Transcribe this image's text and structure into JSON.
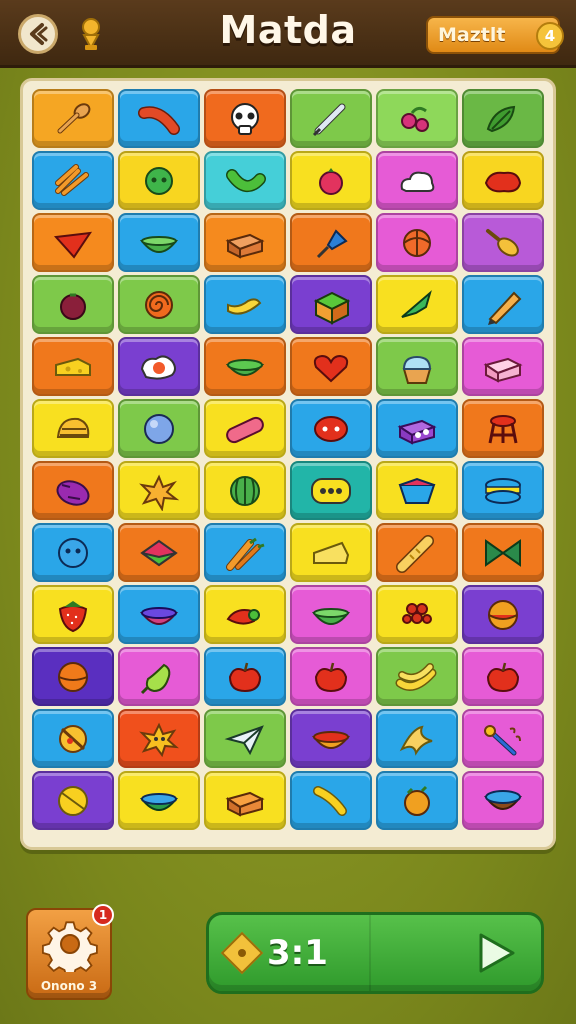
{
  "header": {
    "title": "Matda",
    "right_button_label": "Maztlt",
    "right_button_badge": "4"
  },
  "board": {
    "rows": [
      [
        {
          "color": "#f5a623",
          "icon": "spoon-icon"
        },
        {
          "color": "#2aa6e8",
          "icon": "sausage-icon"
        },
        {
          "color": "#f06a1e",
          "icon": "skull-icon"
        },
        {
          "color": "#7ec94a",
          "icon": "syringe-icon"
        },
        {
          "color": "#8ed85a",
          "icon": "berries-icon"
        },
        {
          "color": "#6ab845",
          "icon": "leaves-icon"
        }
      ],
      [
        {
          "color": "#2aa6e8",
          "icon": "fries-icon"
        },
        {
          "color": "#f8d620",
          "icon": "green-ball-icon"
        },
        {
          "color": "#45cfd8",
          "icon": "pepper-icon"
        },
        {
          "color": "#f8e020",
          "icon": "tomato-icon"
        },
        {
          "color": "#e65bd6",
          "icon": "cloud-icon"
        },
        {
          "color": "#f8d620",
          "icon": "red-blob-icon"
        }
      ],
      [
        {
          "color": "#f58a1e",
          "icon": "triangle-icon"
        },
        {
          "color": "#2aa6e8",
          "icon": "green-bowl-icon"
        },
        {
          "color": "#f58a1e",
          "icon": "box-icon"
        },
        {
          "color": "#f0781c",
          "icon": "pin-icon"
        },
        {
          "color": "#e65bd6",
          "icon": "ball-icon"
        },
        {
          "color": "#b85ad8",
          "icon": "drumstick-icon"
        }
      ],
      [
        {
          "color": "#7ec94a",
          "icon": "berry-icon"
        },
        {
          "color": "#7ec94a",
          "icon": "spiral-icon"
        },
        {
          "color": "#2aa6e8",
          "icon": "banana-icon"
        },
        {
          "color": "#7a3fd0",
          "icon": "cube-icon"
        },
        {
          "color": "#f8e020",
          "icon": "arrow-icon"
        },
        {
          "color": "#2aa6e8",
          "icon": "pencil-icon"
        }
      ],
      [
        {
          "color": "#f0781c",
          "icon": "cheese-icon"
        },
        {
          "color": "#7a3fd0",
          "icon": "egg-icon"
        },
        {
          "color": "#f0781c",
          "icon": "green-dish-icon"
        },
        {
          "color": "#f0781c",
          "icon": "heart-icon"
        },
        {
          "color": "#7ec94a",
          "icon": "cupcake-icon"
        },
        {
          "color": "#e65bd6",
          "icon": "pink-box-icon"
        }
      ],
      [
        {
          "color": "#f8e020",
          "icon": "shell-icon"
        },
        {
          "color": "#7ec94a",
          "icon": "blue-ball-icon"
        },
        {
          "color": "#f8e020",
          "icon": "pill-icon"
        },
        {
          "color": "#2aa6e8",
          "icon": "red-face-icon"
        },
        {
          "color": "#2aa6e8",
          "icon": "purple-block-icon"
        },
        {
          "color": "#f0781c",
          "icon": "stool-icon"
        }
      ],
      [
        {
          "color": "#f0781c",
          "icon": "eggplant-icon"
        },
        {
          "color": "#f8e020",
          "icon": "splash-icon"
        },
        {
          "color": "#f8e020",
          "icon": "melon-icon"
        },
        {
          "color": "#22b5a8",
          "icon": "yellow-face-icon"
        },
        {
          "color": "#f8e020",
          "icon": "gem-icon"
        },
        {
          "color": "#2aa6e8",
          "icon": "macaron-icon"
        }
      ],
      [
        {
          "color": "#2aa6e8",
          "icon": "blue-face-icon"
        },
        {
          "color": "#f0781c",
          "icon": "prism-icon"
        },
        {
          "color": "#2aa6e8",
          "icon": "carrots-icon"
        },
        {
          "color": "#f8e020",
          "icon": "cheese-wedge-icon"
        },
        {
          "color": "#f0781c",
          "icon": "baguette-icon"
        },
        {
          "color": "#f0781c",
          "icon": "bowtie-icon"
        }
      ],
      [
        {
          "color": "#f8e020",
          "icon": "strawberry-icon"
        },
        {
          "color": "#2aa6e8",
          "icon": "purple-bowl-icon"
        },
        {
          "color": "#f8e020",
          "icon": "chili-icon"
        },
        {
          "color": "#e65bd6",
          "icon": "green-bowl-icon"
        },
        {
          "color": "#f8e020",
          "icon": "grapes-icon"
        },
        {
          "color": "#7a3fd0",
          "icon": "orange-ball-icon"
        }
      ],
      [
        {
          "color": "#5a2fc0",
          "icon": "orange-icon"
        },
        {
          "color": "#e65bd6",
          "icon": "pear-icon"
        },
        {
          "color": "#2aa6e8",
          "icon": "apple-icon"
        },
        {
          "color": "#e65bd6",
          "icon": "apple-icon"
        },
        {
          "color": "#7ec94a",
          "icon": "bananas-icon"
        },
        {
          "color": "#e65bd6",
          "icon": "apple-icon"
        }
      ],
      [
        {
          "color": "#2aa6e8",
          "icon": "nut-icon"
        },
        {
          "color": "#f0501c",
          "icon": "star-splat-icon"
        },
        {
          "color": "#7ec94a",
          "icon": "plane-icon"
        },
        {
          "color": "#7a3fd0",
          "icon": "dish-icon"
        },
        {
          "color": "#2aa6e8",
          "icon": "peel-icon"
        },
        {
          "color": "#e65bd6",
          "icon": "wand-icon"
        }
      ],
      [
        {
          "color": "#7a3fd0",
          "icon": "lemon-icon"
        },
        {
          "color": "#f8e020",
          "icon": "teal-bowl-icon"
        },
        {
          "color": "#f8e020",
          "icon": "crate-icon"
        },
        {
          "color": "#2aa6e8",
          "icon": "pepper-yellow-icon"
        },
        {
          "color": "#2aa6e8",
          "icon": "citrus-icon"
        },
        {
          "color": "#e65bd6",
          "icon": "blue-cup-icon"
        }
      ]
    ]
  },
  "footer": {
    "settings_label": "Onono 3",
    "settings_badge": "1",
    "score": "3:1"
  }
}
